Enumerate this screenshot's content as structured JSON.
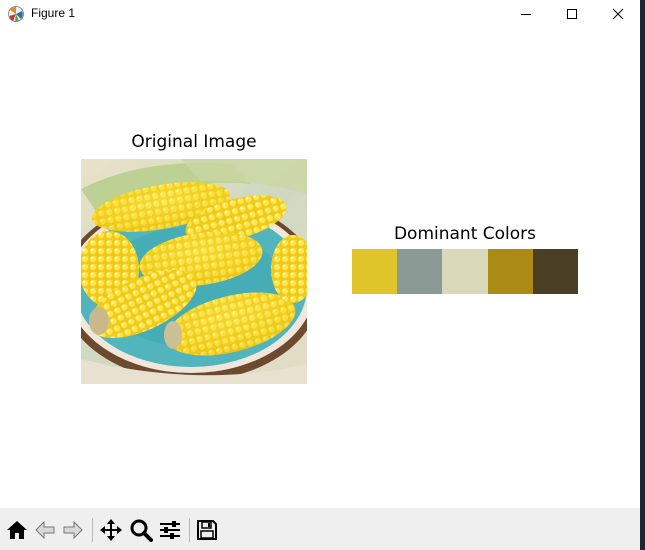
{
  "window": {
    "title": "Figure 1",
    "icon": "matplotlib-figure-icon"
  },
  "controls": {
    "minimize_icon": "minimize-icon",
    "maximize_icon": "maximize-icon",
    "close_icon": "close-icon"
  },
  "figure": {
    "left_title": "Original Image",
    "right_title": "Dominant Colors",
    "image_subject": "corn cobs on a teal plate",
    "dominant_colors": [
      "#e0c52a",
      "#8c9a96",
      "#d9d9b9",
      "#ac8a16",
      "#4a3e24"
    ]
  },
  "toolbar": {
    "items": [
      "home-icon",
      "back-icon",
      "forward-icon",
      "pan-icon",
      "zoom-icon",
      "configure-subplots-icon",
      "save-icon"
    ]
  }
}
